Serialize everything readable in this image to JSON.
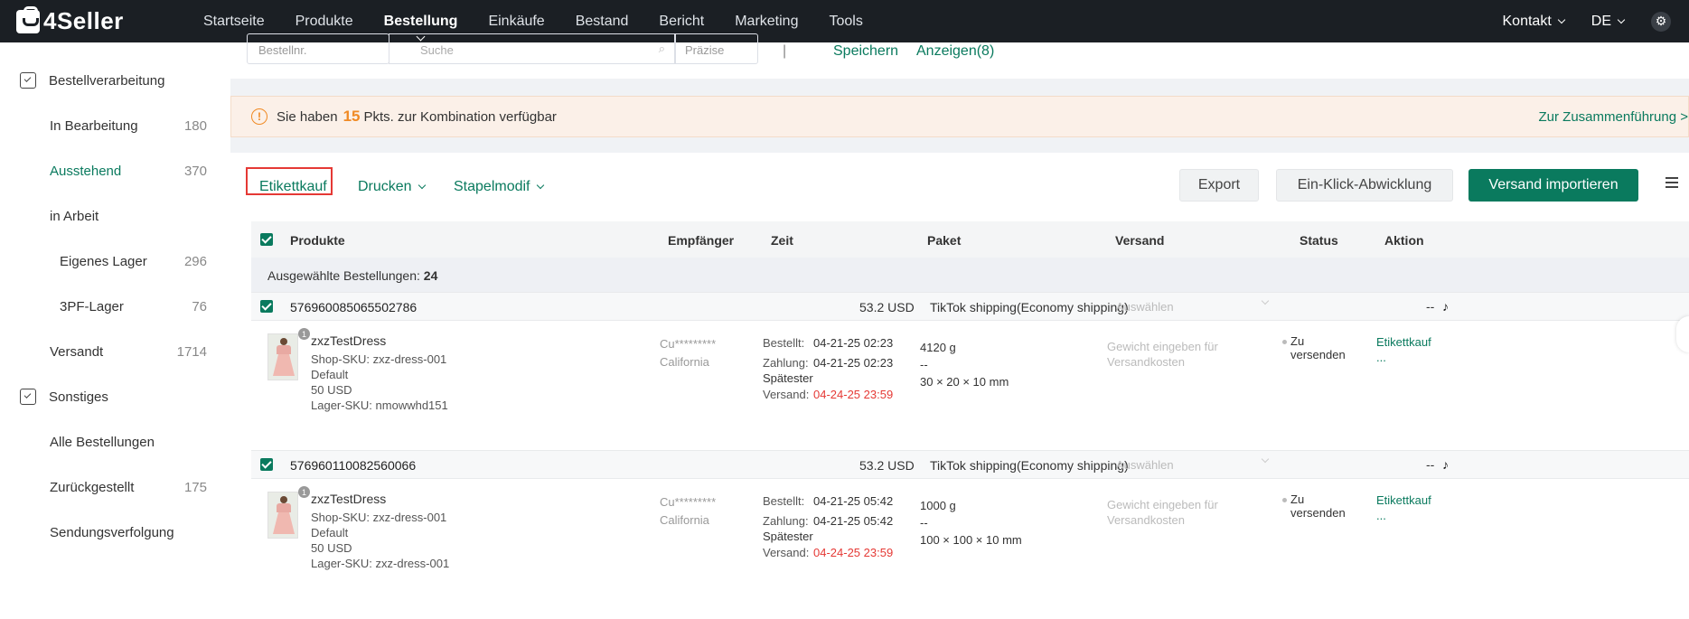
{
  "app": {
    "logo": "4Seller"
  },
  "nav": {
    "items": [
      "Startseite",
      "Produkte",
      "Bestellung",
      "Einkäufe",
      "Bestand",
      "Bericht",
      "Marketing",
      "Tools"
    ],
    "active": "Bestellung",
    "contact": "Kontakt",
    "language": "DE"
  },
  "sidebar": {
    "group1": "Bestellverarbeitung",
    "items": [
      {
        "label": "In Bearbeitung",
        "count": "180"
      },
      {
        "label": "Ausstehend",
        "count": "370"
      },
      {
        "label": "in Arbeit",
        "count": ""
      },
      {
        "label": "Eigenes Lager",
        "count": "296"
      },
      {
        "label": "3PF-Lager",
        "count": "76"
      },
      {
        "label": "Versandt",
        "count": "1714"
      }
    ],
    "group2": "Sonstiges",
    "items2": [
      {
        "label": "Alle Bestellungen",
        "count": ""
      },
      {
        "label": "Zurückgestellt",
        "count": "175"
      },
      {
        "label": "Sendungsverfolgung",
        "count": ""
      }
    ]
  },
  "filter": {
    "order_select": "Bestellnr.",
    "search_placeholder": "Suche",
    "precision": "Präzise",
    "save": "Speichern",
    "show": "Anzeigen(8)"
  },
  "notice": {
    "prefix": "Sie haben",
    "number": "15",
    "suffix": "Pkts. zur Kombination verfügbar",
    "link": "Zur Zusammenführung >"
  },
  "toolbar": {
    "label_buy": "Etikettkauf",
    "print": "Drucken",
    "batch": "Stapelmodif",
    "export": "Export",
    "one_click": "Ein-Klick-Abwicklung",
    "import": "Versand importieren"
  },
  "table": {
    "headers": {
      "products": "Produkte",
      "recipient": "Empfänger",
      "time": "Zeit",
      "package": "Paket",
      "shipping": "Versand",
      "status": "Status",
      "action": "Aktion"
    },
    "selected_label": "Ausgewählte Bestellungen:",
    "selected_count": "24"
  },
  "orders": [
    {
      "id": "576960085065502786",
      "amount": "53.2 USD",
      "shipping": "TikTok shipping(Economy shipping)",
      "select": "Auswählen",
      "dash": "--",
      "qty": "1",
      "name": "zxzTestDress",
      "shop_sku": "Shop-SKU: zxz-dress-001",
      "variant": "Default",
      "price": "50 USD",
      "stock_sku": "Lager-SKU: nmowwhd151",
      "recipient": "Cu*********",
      "state": "California",
      "ordered_label": "Bestellt:",
      "ordered": "04-21-25 02:23",
      "paid_label": "Zahlung:",
      "paid": "04-21-25 02:23",
      "latest_label1": "Spätester",
      "latest_label2": "Versand:",
      "latest": "04-24-25 23:59",
      "weight": "4120 g",
      "pkg_dash": "--",
      "dims": "30 × 20 × 10 mm",
      "ship_hint": "Gewicht eingeben für Versandkosten",
      "status1": "Zu",
      "status2": "versenden",
      "action": "Etikettkauf",
      "more": "..."
    },
    {
      "id": "576960110082560066",
      "amount": "53.2 USD",
      "shipping": "TikTok shipping(Economy shipping)",
      "select": "Auswählen",
      "dash": "--",
      "qty": "1",
      "name": "zxzTestDress",
      "shop_sku": "Shop-SKU: zxz-dress-001",
      "variant": "Default",
      "price": "50 USD",
      "stock_sku": "Lager-SKU: zxz-dress-001",
      "recipient": "Cu*********",
      "state": "California",
      "ordered_label": "Bestellt:",
      "ordered": "04-21-25 05:42",
      "paid_label": "Zahlung:",
      "paid": "04-21-25 05:42",
      "latest_label1": "Spätester",
      "latest_label2": "Versand:",
      "latest": "04-24-25 23:59",
      "weight": "1000 g",
      "pkg_dash": "--",
      "dims": "100 × 100 × 10 mm",
      "ship_hint": "Gewicht eingeben für Versandkosten",
      "status1": "Zu",
      "status2": "versenden",
      "action": "Etikettkauf",
      "more": "..."
    }
  ],
  "colors": {
    "accent": "#0a7a5e",
    "warning": "#f08a24",
    "highlight": "#e53935",
    "topbar": "#1b1f24"
  },
  "icons": [
    "logo-icon",
    "settings-gear-icon",
    "clipboard-check-icon",
    "warning-icon",
    "search-icon",
    "tiktok-icon",
    "column-settings-icon",
    "annotation-arrow"
  ]
}
